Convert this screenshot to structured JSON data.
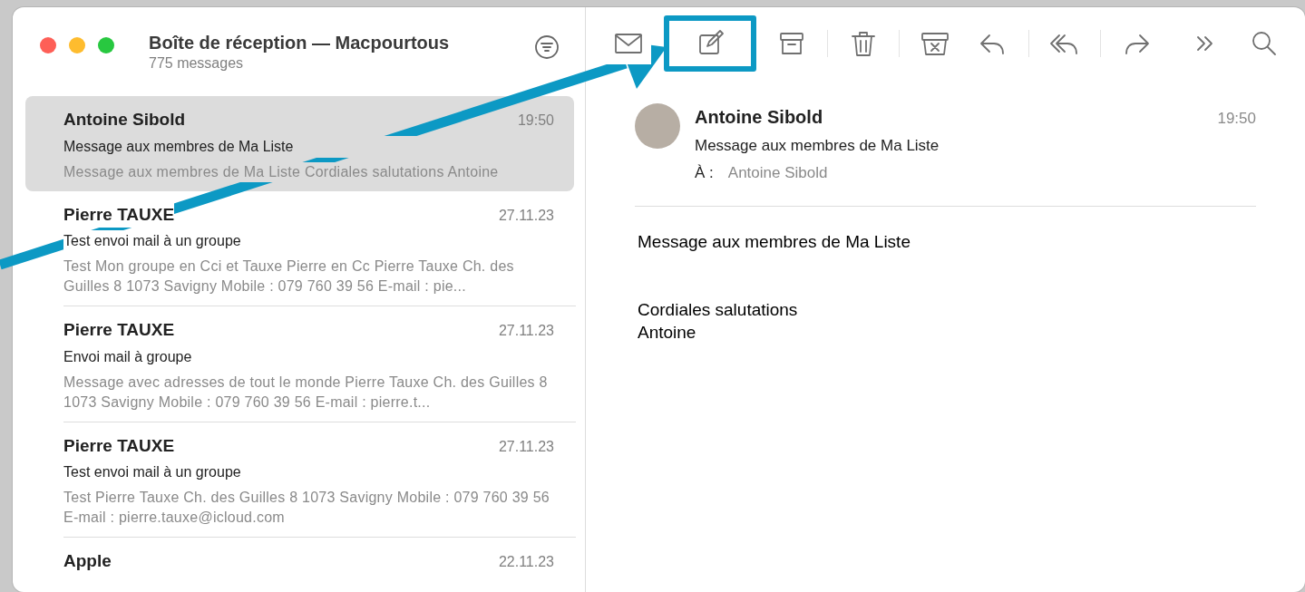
{
  "window": {
    "title": "Boîte de réception — Macpourtous",
    "subtitle": "775 messages"
  },
  "toolbar": [
    {
      "kind": "mail",
      "highlighted": false
    },
    {
      "kind": "compose",
      "highlighted": true
    },
    {
      "kind": "archive",
      "highlighted": false
    },
    {
      "kind": "trash",
      "highlighted": false
    },
    {
      "kind": "junk",
      "highlighted": false
    },
    {
      "kind": "reply",
      "highlighted": false
    },
    {
      "kind": "reply-all",
      "highlighted": false
    },
    {
      "kind": "forward",
      "highlighted": false
    },
    {
      "kind": "more",
      "highlighted": false
    },
    {
      "kind": "search",
      "highlighted": false
    }
  ],
  "messages": [
    {
      "sender": "Antoine Sibold",
      "date": "19:50",
      "subject": "Message aux membres de Ma Liste",
      "preview": "Message aux membres de Ma Liste Cordiales salutations Antoine",
      "selected": true
    },
    {
      "sender": "Pierre TAUXE",
      "date": "27.11.23",
      "subject": "Test envoi mail à un groupe",
      "preview": "Test Mon groupe en Cci et Tauxe Pierre en Cc Pierre Tauxe Ch. des Guilles 8 1073 Savigny Mobile : 079 760 39 56 E-mail : pie...",
      "selected": false
    },
    {
      "sender": "Pierre TAUXE",
      "date": "27.11.23",
      "subject": "Envoi mail à groupe",
      "preview": "Message avec adresses de tout le monde Pierre Tauxe Ch. des Guilles 8 1073 Savigny Mobile : 079 760 39 56 E-mail : pierre.t...",
      "selected": false
    },
    {
      "sender": "Pierre TAUXE",
      "date": "27.11.23",
      "subject": "Test envoi mail à un groupe",
      "preview": "Test Pierre Tauxe Ch. des Guilles 8 1073 Savigny Mobile : 079 760 39 56 E-mail : pierre.tauxe@icloud.com",
      "selected": false
    },
    {
      "sender": "Apple",
      "date": "22.11.23",
      "selected": false
    }
  ],
  "reader": {
    "sender": "Antoine Sibold",
    "time": "19:50",
    "subject": "Message aux membres de Ma Liste",
    "to_label": "À :",
    "to": "Antoine Sibold",
    "body": [
      "Message aux membres de Ma Liste",
      "Cordiales salutations\nAntoine"
    ]
  }
}
